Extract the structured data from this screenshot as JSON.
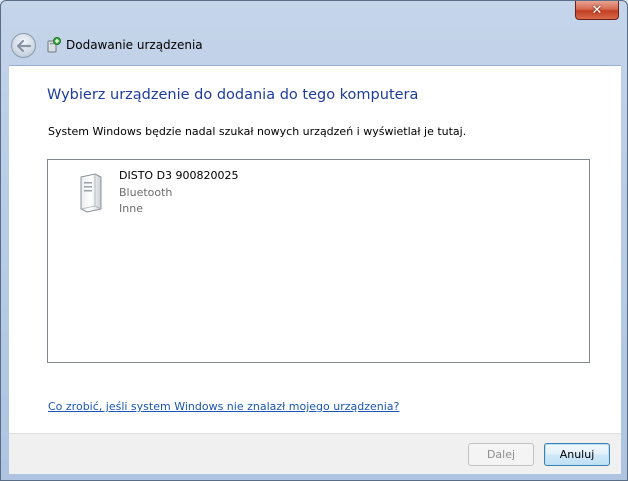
{
  "window": {
    "title": "Dodawanie urządzenia",
    "close_glyph": "✕"
  },
  "main": {
    "heading": "Wybierz urządzenie do dodania do tego komputera",
    "subtext": "System Windows będzie nadal szukał nowych urządzeń i wyświetlał je tutaj.",
    "devices": [
      {
        "name": "DISTO D3 900820025",
        "type": "Bluetooth",
        "category": "Inne",
        "icon": "device-tower-icon"
      }
    ],
    "help_link": "Co zrobić, jeśli system Windows nie znalazł mojego urządzenia?"
  },
  "footer": {
    "next_label": "Dalej",
    "cancel_label": "Anuluj"
  },
  "colors": {
    "heading": "#1e3d9a",
    "link": "#1a56b5",
    "close_button": "#c23f22"
  }
}
